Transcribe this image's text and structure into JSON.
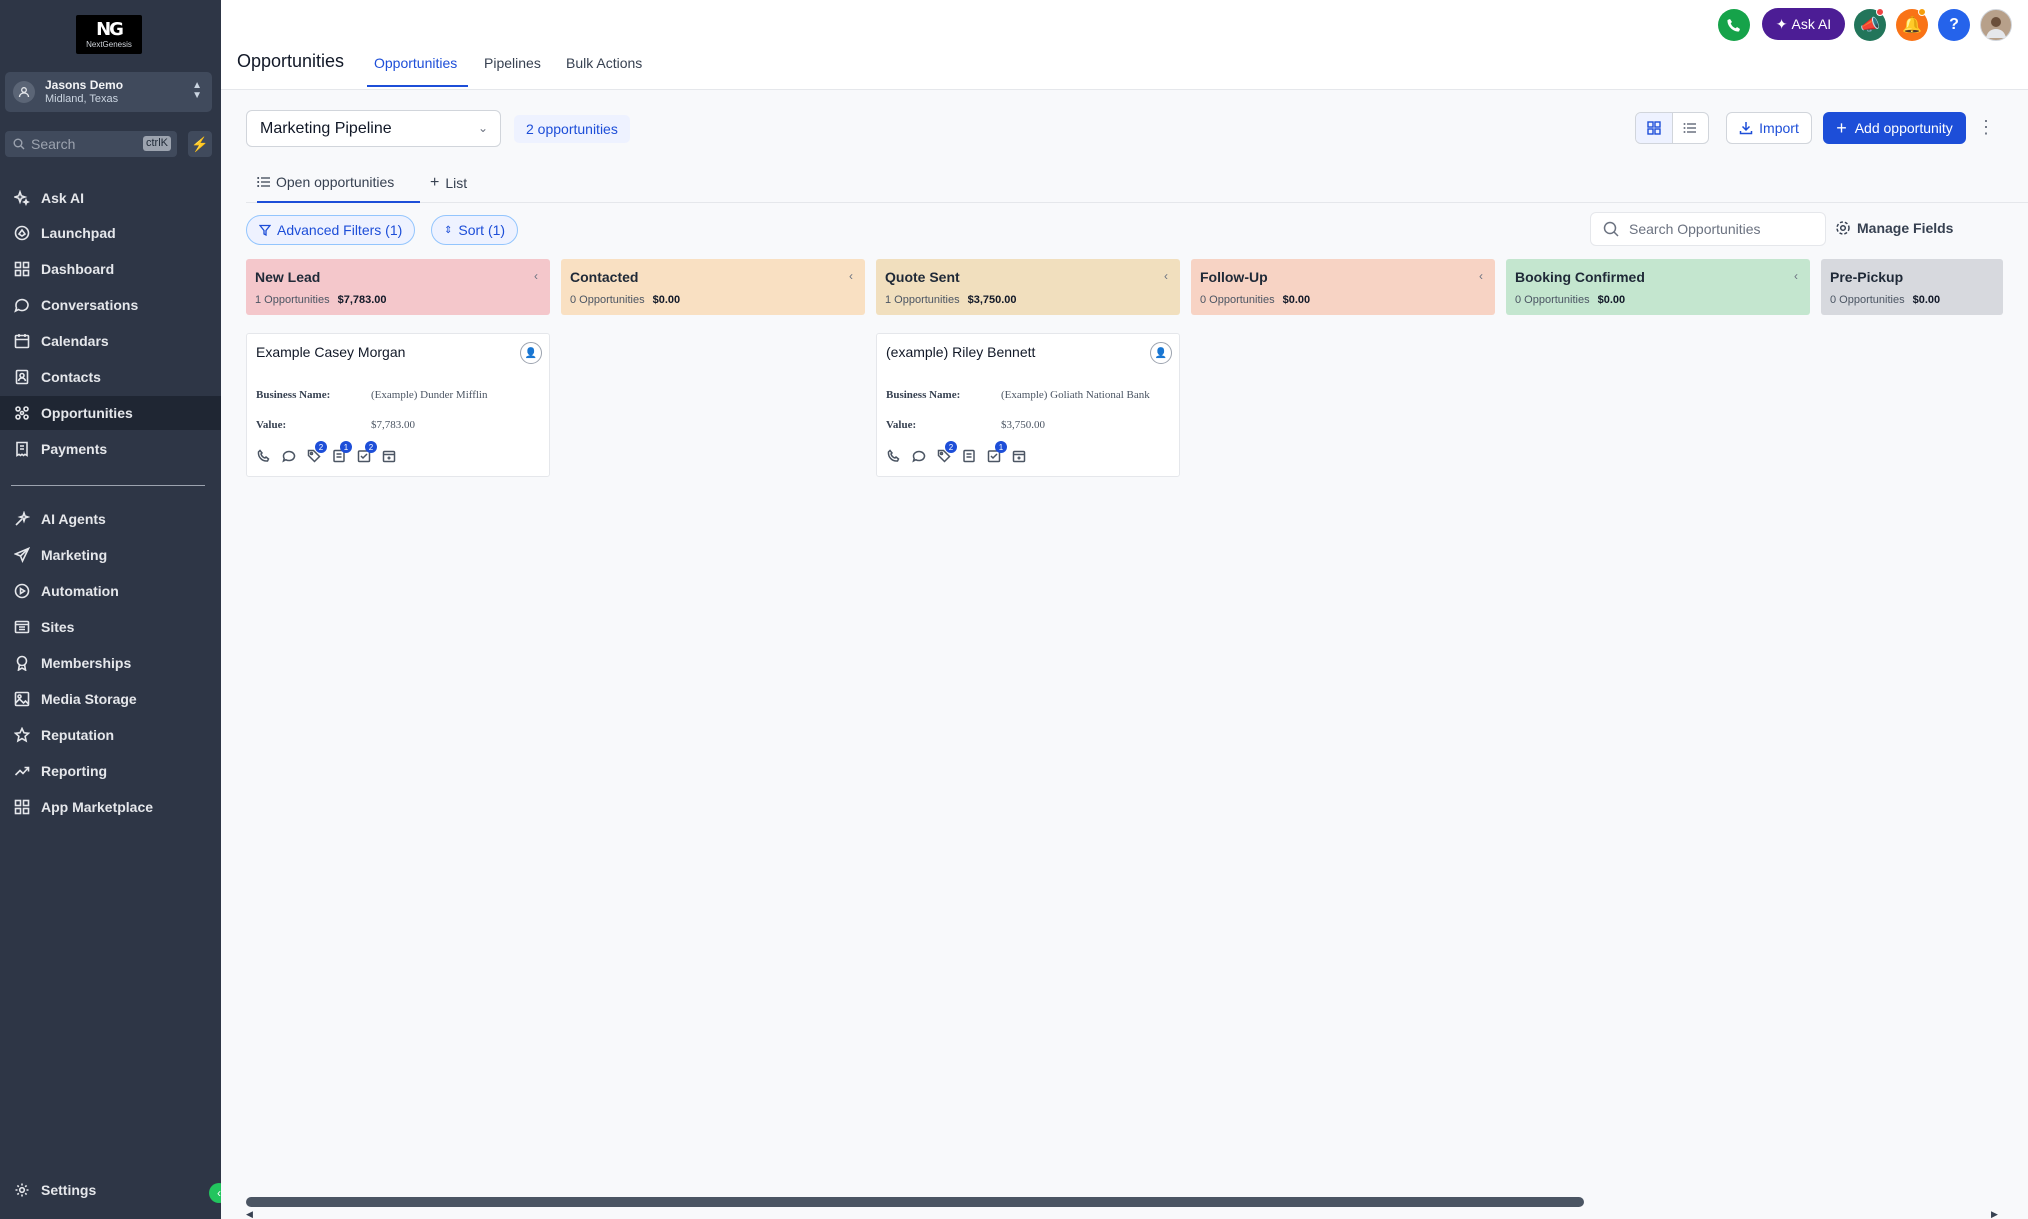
{
  "sidebar": {
    "logo_text": "NextGenesis",
    "account_name": "Jasons Demo",
    "account_location": "Midland, Texas",
    "search_placeholder": "Search",
    "search_shortcut": "ctrlK",
    "items": [
      {
        "label": "Ask AI",
        "icon": "sparkle-icon"
      },
      {
        "label": "Launchpad",
        "icon": "rocket-icon"
      },
      {
        "label": "Dashboard",
        "icon": "dashboard-icon"
      },
      {
        "label": "Conversations",
        "icon": "chat-icon"
      },
      {
        "label": "Calendars",
        "icon": "calendar-icon"
      },
      {
        "label": "Contacts",
        "icon": "contacts-icon"
      },
      {
        "label": "Opportunities",
        "icon": "opportunities-icon"
      },
      {
        "label": "Payments",
        "icon": "payments-icon"
      },
      {
        "label": "AI Agents",
        "icon": "ai-agents-icon"
      },
      {
        "label": "Marketing",
        "icon": "send-icon"
      },
      {
        "label": "Automation",
        "icon": "automation-icon"
      },
      {
        "label": "Sites",
        "icon": "sites-icon"
      },
      {
        "label": "Memberships",
        "icon": "badge-icon"
      },
      {
        "label": "Media Storage",
        "icon": "image-icon"
      },
      {
        "label": "Reputation",
        "icon": "star-icon"
      },
      {
        "label": "Reporting",
        "icon": "trend-icon"
      },
      {
        "label": "App Marketplace",
        "icon": "apps-icon"
      }
    ],
    "settings_label": "Settings"
  },
  "header": {
    "title": "Opportunities",
    "tabs": [
      "Opportunities",
      "Pipelines",
      "Bulk Actions"
    ],
    "ask_ai_label": "Ask AI",
    "help_label": "?"
  },
  "toolbar": {
    "pipeline": "Marketing Pipeline",
    "count": "2 opportunities",
    "import_label": "Import",
    "add_label": "Add opportunity",
    "subtabs": [
      "Open opportunities",
      "List"
    ],
    "advanced_filters": "Advanced Filters (1)",
    "sort": "Sort (1)",
    "search_placeholder": "Search Opportunities",
    "manage_fields": "Manage Fields"
  },
  "stages": [
    {
      "name": "New Lead",
      "count": "1 Opportunities",
      "amount": "$7,783.00",
      "color": "#f4c7cb"
    },
    {
      "name": "Contacted",
      "count": "0 Opportunities",
      "amount": "$0.00",
      "color": "#f9e0c2"
    },
    {
      "name": "Quote Sent",
      "count": "1 Opportunities",
      "amount": "$3,750.00",
      "color": "#f1dfbe"
    },
    {
      "name": "Follow-Up",
      "count": "0 Opportunities",
      "amount": "$0.00",
      "color": "#f7d3c4"
    },
    {
      "name": "Booking Confirmed",
      "count": "0 Opportunities",
      "amount": "$0.00",
      "color": "#c4e6cf"
    },
    {
      "name": "Pre-Pickup",
      "count": "0 Opportunities",
      "amount": "$0.00",
      "color": "#d7d9de"
    }
  ],
  "cards": [
    {
      "title": "Example Casey Morgan",
      "business_label": "Business Name:",
      "business": "(Example) Dunder Mifflin",
      "value_label": "Value:",
      "value": "$7,783.00",
      "badges": [
        "",
        "",
        "2",
        "1",
        "2",
        ""
      ]
    },
    {
      "title": "(example) Riley Bennett",
      "business_label": "Business Name:",
      "business": "(Example) Goliath National Bank",
      "value_label": "Value:",
      "value": "$3,750.00",
      "badges": [
        "",
        "",
        "2",
        "",
        "1",
        ""
      ]
    }
  ],
  "colors": {
    "accent": "#1d4ed8",
    "sidebar": "#2e3646",
    "ask_ai": "#4c1d95"
  }
}
